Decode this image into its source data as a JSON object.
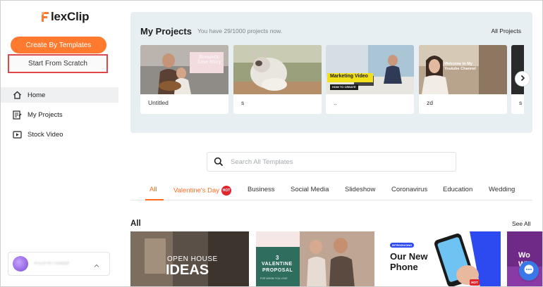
{
  "brand": {
    "name": "lexClip",
    "accent": "#ff7a2e"
  },
  "sidebar": {
    "create_templates_label": "Create By Templates",
    "start_scratch_label": "Start From Scratch",
    "nav": [
      {
        "label": "Home",
        "icon": "home-icon"
      },
      {
        "label": "My Projects",
        "icon": "projects-icon"
      },
      {
        "label": "Stock Video",
        "icon": "video-icon"
      }
    ],
    "user": {
      "name": "ASDFWTRaaqe"
    }
  },
  "projects": {
    "title": "My Projects",
    "subtitle": "You have 29/1000 projects now.",
    "all_link": "All Projects",
    "cards": [
      {
        "title": "Untitled",
        "overlay": "Romantic Love Story"
      },
      {
        "title": "s"
      },
      {
        "title": "..",
        "overlay": "Marketing Video",
        "overlay2": "HOW TO CREATE"
      },
      {
        "title": "zd",
        "overlay": "Welcome to My Youtube Channel"
      },
      {
        "title": "s"
      }
    ]
  },
  "search": {
    "placeholder": "Search All Templates"
  },
  "tabs": [
    {
      "label": "All"
    },
    {
      "label": "Valentine's Day",
      "badge": "HOT"
    },
    {
      "label": "Business"
    },
    {
      "label": "Social Media"
    },
    {
      "label": "Slideshow"
    },
    {
      "label": "Coronavirus"
    },
    {
      "label": "Education"
    },
    {
      "label": "Wedding"
    }
  ],
  "templates": {
    "title": "All",
    "see_all": "See All",
    "cards": [
      {
        "line1": "OPEN HOUSE",
        "line2": "IDEAS"
      },
      {
        "line1": "3",
        "line2": "VALENTINE",
        "line3": "PROPOSAL",
        "line4": "FOR WHOM YOU LOVE"
      },
      {
        "tag": "INTRODUCING",
        "line1": "Our New",
        "line2": "Phone",
        "badge": "HOT"
      },
      {
        "line1": "Wo",
        "line2": "Wi"
      }
    ]
  }
}
